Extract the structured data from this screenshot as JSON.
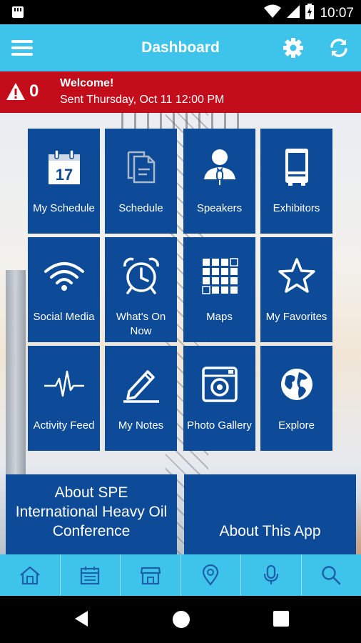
{
  "status_bar": {
    "time": "10:07"
  },
  "app_bar": {
    "title": "Dashboard"
  },
  "alert": {
    "count": "0",
    "title": "Welcome!",
    "subtitle": "Sent Thursday, Oct 11 12:00 PM"
  },
  "tiles": [
    {
      "label": "My Schedule",
      "icon": "calendar-17-icon",
      "calendar_day": "17"
    },
    {
      "label": "Schedule",
      "icon": "documents-icon"
    },
    {
      "label": "Speakers",
      "icon": "speaker-icon"
    },
    {
      "label": "Exhibitors",
      "icon": "booth-icon"
    },
    {
      "label": "Social Media",
      "icon": "wifi-icon"
    },
    {
      "label": "What's On Now",
      "icon": "alarm-clock-icon"
    },
    {
      "label": "Maps",
      "icon": "floor-map-icon"
    },
    {
      "label": "My Favorites",
      "icon": "star-icon"
    },
    {
      "label": "Activity Feed",
      "icon": "pulse-icon"
    },
    {
      "label": "My Notes",
      "icon": "pencil-icon"
    },
    {
      "label": "Photo Gallery",
      "icon": "camera-icon"
    },
    {
      "label": "Explore",
      "icon": "globe-icon"
    }
  ],
  "big_tiles": [
    {
      "label": "About SPE International Heavy Oil Conference"
    },
    {
      "label": "About This App"
    }
  ],
  "bottom_nav": [
    {
      "name": "home",
      "icon": "home-icon"
    },
    {
      "name": "schedule",
      "icon": "calendar-icon"
    },
    {
      "name": "exhibitors",
      "icon": "storefront-icon"
    },
    {
      "name": "maps",
      "icon": "map-pin-icon"
    },
    {
      "name": "speakers",
      "icon": "microphone-icon"
    },
    {
      "name": "search",
      "icon": "search-icon"
    }
  ],
  "colors": {
    "app_bar": "#3ec3ea",
    "alert": "#c30d1b",
    "tile": "#0d4a97"
  }
}
